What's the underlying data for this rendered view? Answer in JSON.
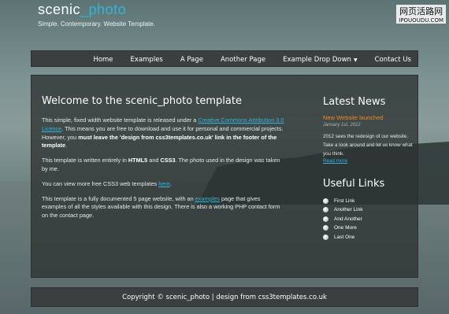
{
  "header": {
    "logo_main": "scenic",
    "logo_accent": "_photo",
    "slogan": "Simple. Contemporary. Website Template.",
    "watermark_line1": "网页活路网",
    "watermark_line2": "IPOUOUDU.COM"
  },
  "menu": [
    {
      "label": "Home"
    },
    {
      "label": "Examples"
    },
    {
      "label": "A Page"
    },
    {
      "label": "Another Page"
    },
    {
      "label": "Example Drop Down",
      "caret": "▼"
    },
    {
      "label": "Contact Us"
    }
  ],
  "main": {
    "heading": "Welcome to the scenic_photo template",
    "p1_pre": "This simple, fixed width website template is released under a ",
    "p1_link": "Creative Commons Attribution 3.0 Licence",
    "p1_mid": ". This means you are free to download and use it for personal and commercial projects. However, you ",
    "p1_bold": "must leave the 'design from css3templates.co.uk' link in the footer of the template",
    "p1_post": ".",
    "p2_pre": "This template is written entirely in ",
    "p2_b1": "HTML5",
    "p2_mid": " and ",
    "p2_b2": "CSS3",
    "p2_post": ". The photo used in the design was taken by me.",
    "p3_pre": "You can view more free CSS3 web templates ",
    "p3_link": "here",
    "p3_post": ".",
    "p4_pre": "This template is a fully documented 5 page website, with an ",
    "p4_link": "examples",
    "p4_post": " page that gives examples of all the styles available with this design. There is also a working PHP contact form on the contact page."
  },
  "sidebar": {
    "news_heading": "Latest News",
    "news_title": "New Website launched",
    "news_date": "January 1st, 2012",
    "news_body": "2012 sees the redesign of our website. Take a look around and let us know what you think.",
    "news_more": "Read more",
    "links_heading": "Useful Links",
    "links": [
      {
        "label": "First Link"
      },
      {
        "label": "Another Link"
      },
      {
        "label": "And Another"
      },
      {
        "label": "One More"
      },
      {
        "label": "Last One"
      }
    ]
  },
  "footer": {
    "text": "Copyright © scenic_photo | design from css3templates.co.uk"
  },
  "colors": {
    "accent": "#2fb6dc",
    "news_title": "#f08a1a",
    "panel": "#2d3232"
  }
}
